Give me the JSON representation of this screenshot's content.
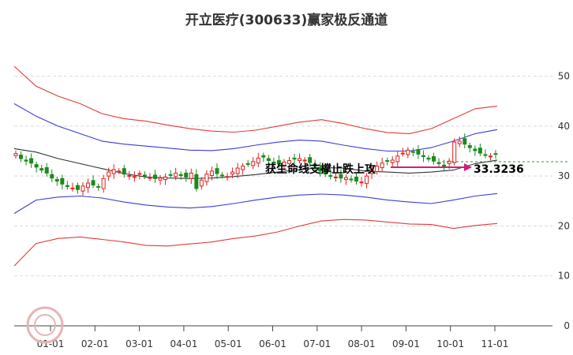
{
  "chart_data": {
    "type": "candlestick",
    "title": "开立医疗(300633)赢家极反通道",
    "xlabel": "",
    "ylabel": "",
    "ylim": [
      0,
      55
    ],
    "y_ticks": [
      0,
      10,
      20,
      30,
      40,
      50
    ],
    "x_ticks": [
      "01-01",
      "02-01",
      "03-01",
      "04-01",
      "05-01",
      "06-01",
      "07-01",
      "08-01",
      "09-01",
      "10-01",
      "11-01"
    ],
    "grid": "horizontal dashed",
    "annotation": "获生命线支撑止跌上攻",
    "last_price_label": "33.3236",
    "last_price": 33.3236,
    "candles_approx_close": [
      34.5,
      33.5,
      33.0,
      32.6,
      31.8,
      31.2,
      30.6,
      29.6,
      29.0,
      28.4,
      27.9,
      27.6,
      27.3,
      28.0,
      28.6,
      28.2,
      27.8,
      29.5,
      30.8,
      31.3,
      31.0,
      30.4,
      30.1,
      29.9,
      30.5,
      30.0,
      29.7,
      29.5,
      29.6,
      29.8,
      30.2,
      30.6,
      30.1,
      29.8,
      30.6,
      27.5,
      29.2,
      30.4,
      31.0,
      30.5,
      30.1,
      29.9,
      30.8,
      31.6,
      32.0,
      32.4,
      32.9,
      33.6,
      33.8,
      33.1,
      32.6,
      32.4,
      32.8,
      33.1,
      33.4,
      33.5,
      33.2,
      32.7,
      32.0,
      31.0,
      30.4,
      30.0,
      29.8,
      29.6,
      29.7,
      29.3,
      29.0,
      28.8,
      30.0,
      31.2,
      32.0,
      32.6,
      33.0,
      33.2,
      34.0,
      34.6,
      35.2,
      34.8,
      34.4,
      33.9,
      33.4,
      33.0,
      32.5,
      32.0,
      33.0,
      36.8,
      37.0,
      36.4,
      35.7,
      35.1,
      34.6,
      34.3,
      34.0,
      34.4
    ],
    "series": [
      {
        "name": "",
        "role": "outer-upper",
        "color": "#e23a3a",
        "values": [
          52,
          48,
          46,
          44.5,
          42.5,
          41.5,
          41,
          40.2,
          39.5,
          39,
          38.8,
          39.2,
          40,
          40.8,
          41.3,
          40.5,
          39.5,
          38.7,
          38.5,
          39.5,
          41.5,
          43.5,
          44
        ]
      },
      {
        "name": "",
        "role": "inner-upper",
        "color": "#3b3bdc",
        "values": [
          44.5,
          42,
          40,
          38.5,
          37,
          36.4,
          36,
          35.6,
          35.2,
          35.1,
          35.5,
          36.2,
          36.8,
          37.2,
          37,
          36.2,
          35.5,
          35,
          35,
          35.7,
          37,
          38.5,
          39.3
        ]
      },
      {
        "name": "",
        "role": "centre",
        "color": "#333333",
        "values": [
          35.5,
          34.8,
          33.5,
          32.5,
          31.5,
          30.5,
          29.8,
          29.6,
          29.5,
          29.6,
          29.9,
          30.3,
          30.8,
          31.3,
          31.7,
          31.6,
          31,
          30.8,
          30.6,
          30.8,
          31.2,
          32.5,
          33.2
        ]
      },
      {
        "name": "",
        "role": "inner-lower",
        "color": "#3b3bdc",
        "values": [
          22.5,
          25.2,
          25.8,
          26,
          25.6,
          24.8,
          24.2,
          23.8,
          23.6,
          23.9,
          24.5,
          25.2,
          25.8,
          26.2,
          26.4,
          26.2,
          25.8,
          25.2,
          24.8,
          24.5,
          25.2,
          26,
          26.5
        ]
      },
      {
        "name": "",
        "role": "outer-lower",
        "color": "#e23a3a",
        "values": [
          12,
          16.5,
          17.5,
          17.8,
          17.3,
          16.8,
          16.1,
          16,
          16.4,
          16.8,
          17.5,
          18,
          18.8,
          20,
          21,
          21.3,
          21.2,
          20.8,
          20.4,
          20.3,
          19.5,
          20.1,
          20.5
        ]
      }
    ]
  }
}
